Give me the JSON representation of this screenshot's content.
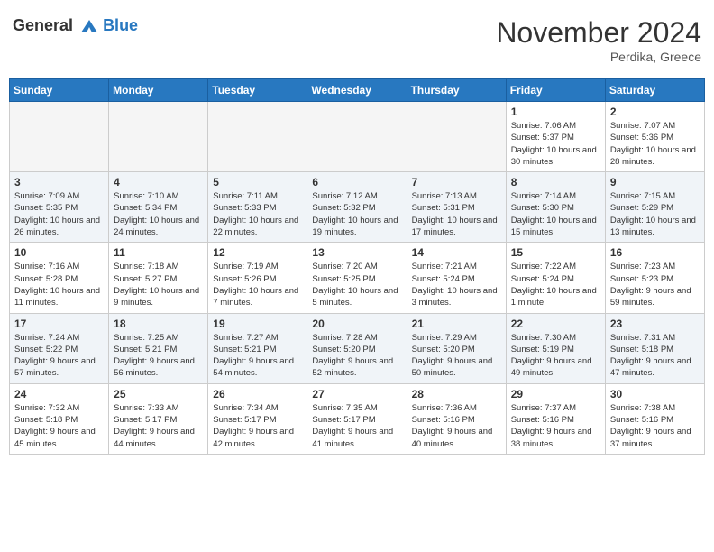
{
  "header": {
    "logo_line1": "General",
    "logo_line2": "Blue",
    "month": "November 2024",
    "location": "Perdika, Greece"
  },
  "weekdays": [
    "Sunday",
    "Monday",
    "Tuesday",
    "Wednesday",
    "Thursday",
    "Friday",
    "Saturday"
  ],
  "weeks": [
    [
      {
        "day": "",
        "info": ""
      },
      {
        "day": "",
        "info": ""
      },
      {
        "day": "",
        "info": ""
      },
      {
        "day": "",
        "info": ""
      },
      {
        "day": "",
        "info": ""
      },
      {
        "day": "1",
        "info": "Sunrise: 7:06 AM\nSunset: 5:37 PM\nDaylight: 10 hours and 30 minutes."
      },
      {
        "day": "2",
        "info": "Sunrise: 7:07 AM\nSunset: 5:36 PM\nDaylight: 10 hours and 28 minutes."
      }
    ],
    [
      {
        "day": "3",
        "info": "Sunrise: 7:09 AM\nSunset: 5:35 PM\nDaylight: 10 hours and 26 minutes."
      },
      {
        "day": "4",
        "info": "Sunrise: 7:10 AM\nSunset: 5:34 PM\nDaylight: 10 hours and 24 minutes."
      },
      {
        "day": "5",
        "info": "Sunrise: 7:11 AM\nSunset: 5:33 PM\nDaylight: 10 hours and 22 minutes."
      },
      {
        "day": "6",
        "info": "Sunrise: 7:12 AM\nSunset: 5:32 PM\nDaylight: 10 hours and 19 minutes."
      },
      {
        "day": "7",
        "info": "Sunrise: 7:13 AM\nSunset: 5:31 PM\nDaylight: 10 hours and 17 minutes."
      },
      {
        "day": "8",
        "info": "Sunrise: 7:14 AM\nSunset: 5:30 PM\nDaylight: 10 hours and 15 minutes."
      },
      {
        "day": "9",
        "info": "Sunrise: 7:15 AM\nSunset: 5:29 PM\nDaylight: 10 hours and 13 minutes."
      }
    ],
    [
      {
        "day": "10",
        "info": "Sunrise: 7:16 AM\nSunset: 5:28 PM\nDaylight: 10 hours and 11 minutes."
      },
      {
        "day": "11",
        "info": "Sunrise: 7:18 AM\nSunset: 5:27 PM\nDaylight: 10 hours and 9 minutes."
      },
      {
        "day": "12",
        "info": "Sunrise: 7:19 AM\nSunset: 5:26 PM\nDaylight: 10 hours and 7 minutes."
      },
      {
        "day": "13",
        "info": "Sunrise: 7:20 AM\nSunset: 5:25 PM\nDaylight: 10 hours and 5 minutes."
      },
      {
        "day": "14",
        "info": "Sunrise: 7:21 AM\nSunset: 5:24 PM\nDaylight: 10 hours and 3 minutes."
      },
      {
        "day": "15",
        "info": "Sunrise: 7:22 AM\nSunset: 5:24 PM\nDaylight: 10 hours and 1 minute."
      },
      {
        "day": "16",
        "info": "Sunrise: 7:23 AM\nSunset: 5:23 PM\nDaylight: 9 hours and 59 minutes."
      }
    ],
    [
      {
        "day": "17",
        "info": "Sunrise: 7:24 AM\nSunset: 5:22 PM\nDaylight: 9 hours and 57 minutes."
      },
      {
        "day": "18",
        "info": "Sunrise: 7:25 AM\nSunset: 5:21 PM\nDaylight: 9 hours and 56 minutes."
      },
      {
        "day": "19",
        "info": "Sunrise: 7:27 AM\nSunset: 5:21 PM\nDaylight: 9 hours and 54 minutes."
      },
      {
        "day": "20",
        "info": "Sunrise: 7:28 AM\nSunset: 5:20 PM\nDaylight: 9 hours and 52 minutes."
      },
      {
        "day": "21",
        "info": "Sunrise: 7:29 AM\nSunset: 5:20 PM\nDaylight: 9 hours and 50 minutes."
      },
      {
        "day": "22",
        "info": "Sunrise: 7:30 AM\nSunset: 5:19 PM\nDaylight: 9 hours and 49 minutes."
      },
      {
        "day": "23",
        "info": "Sunrise: 7:31 AM\nSunset: 5:18 PM\nDaylight: 9 hours and 47 minutes."
      }
    ],
    [
      {
        "day": "24",
        "info": "Sunrise: 7:32 AM\nSunset: 5:18 PM\nDaylight: 9 hours and 45 minutes."
      },
      {
        "day": "25",
        "info": "Sunrise: 7:33 AM\nSunset: 5:17 PM\nDaylight: 9 hours and 44 minutes."
      },
      {
        "day": "26",
        "info": "Sunrise: 7:34 AM\nSunset: 5:17 PM\nDaylight: 9 hours and 42 minutes."
      },
      {
        "day": "27",
        "info": "Sunrise: 7:35 AM\nSunset: 5:17 PM\nDaylight: 9 hours and 41 minutes."
      },
      {
        "day": "28",
        "info": "Sunrise: 7:36 AM\nSunset: 5:16 PM\nDaylight: 9 hours and 40 minutes."
      },
      {
        "day": "29",
        "info": "Sunrise: 7:37 AM\nSunset: 5:16 PM\nDaylight: 9 hours and 38 minutes."
      },
      {
        "day": "30",
        "info": "Sunrise: 7:38 AM\nSunset: 5:16 PM\nDaylight: 9 hours and 37 minutes."
      }
    ]
  ]
}
